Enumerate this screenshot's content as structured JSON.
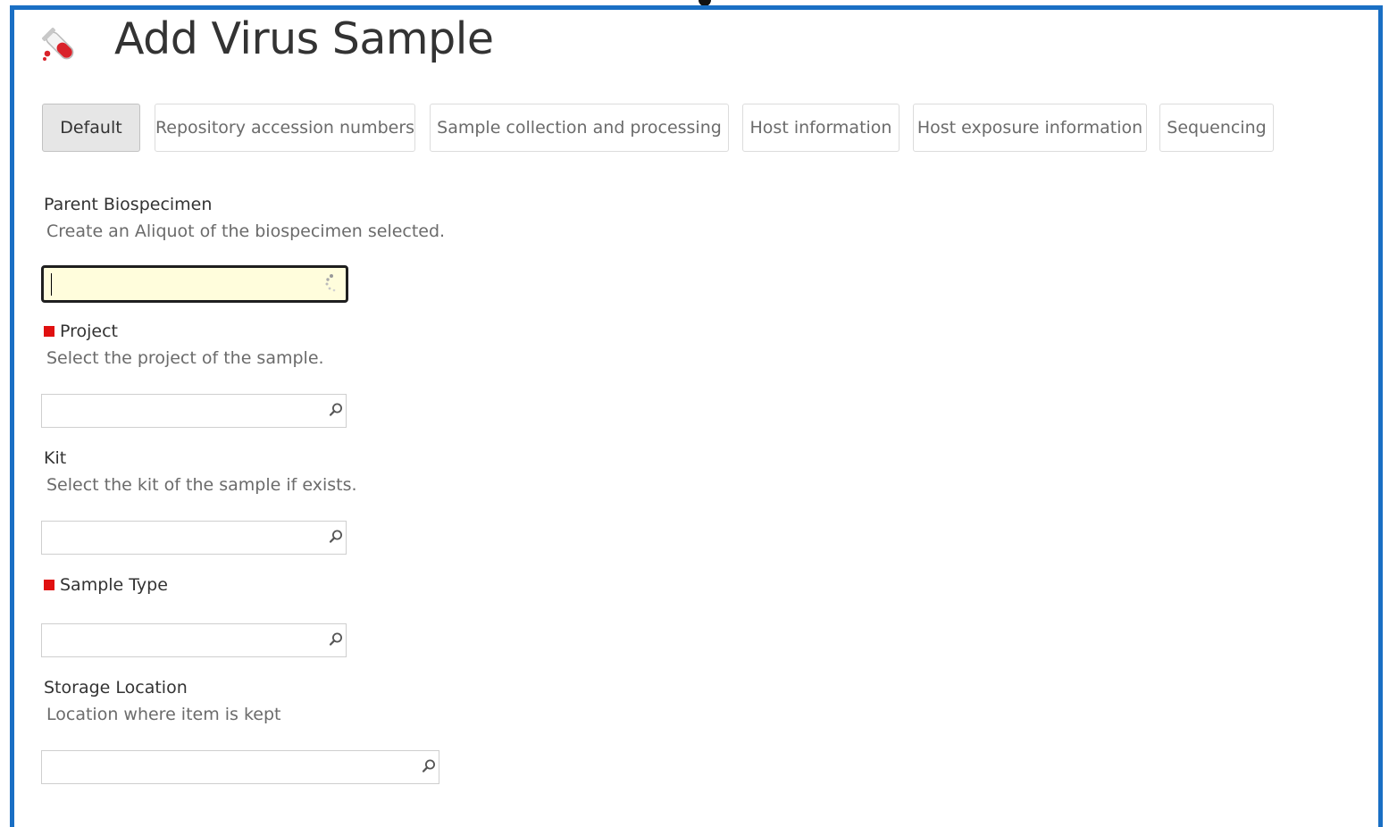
{
  "page": {
    "title": "Add Virus Sample",
    "title_icon": "test-tube-icon"
  },
  "tabs": [
    {
      "label": "Default",
      "active": true
    },
    {
      "label": "Repository accession numbers",
      "active": false
    },
    {
      "label": "Sample collection and processing",
      "active": false
    },
    {
      "label": "Host information",
      "active": false
    },
    {
      "label": "Host exposure information",
      "active": false
    },
    {
      "label": "Sequencing",
      "active": false
    }
  ],
  "fields": {
    "parent_biospecimen": {
      "label": "Parent Biospecimen",
      "help": "Create an Aliquot of the biospecimen selected.",
      "required": false,
      "value": "",
      "icon": "loading-spinner-icon"
    },
    "project": {
      "label": "Project",
      "help": "Select the project of the sample.",
      "required": true,
      "value": "",
      "icon": "search-icon"
    },
    "kit": {
      "label": "Kit",
      "help": "Select the kit of the sample if exists.",
      "required": false,
      "value": "",
      "icon": "search-icon"
    },
    "sample_type": {
      "label": "Sample Type",
      "required": true,
      "value": "",
      "icon": "search-icon"
    },
    "storage_location": {
      "label": "Storage Location",
      "help": "Location where item is kept",
      "required": false,
      "value": "",
      "icon": "search-icon"
    }
  },
  "colors": {
    "frame_border": "#1a6fc4",
    "required_marker": "#e01010",
    "focused_input_bg": "#fffddc",
    "active_tab_bg": "#e6e6e6"
  }
}
